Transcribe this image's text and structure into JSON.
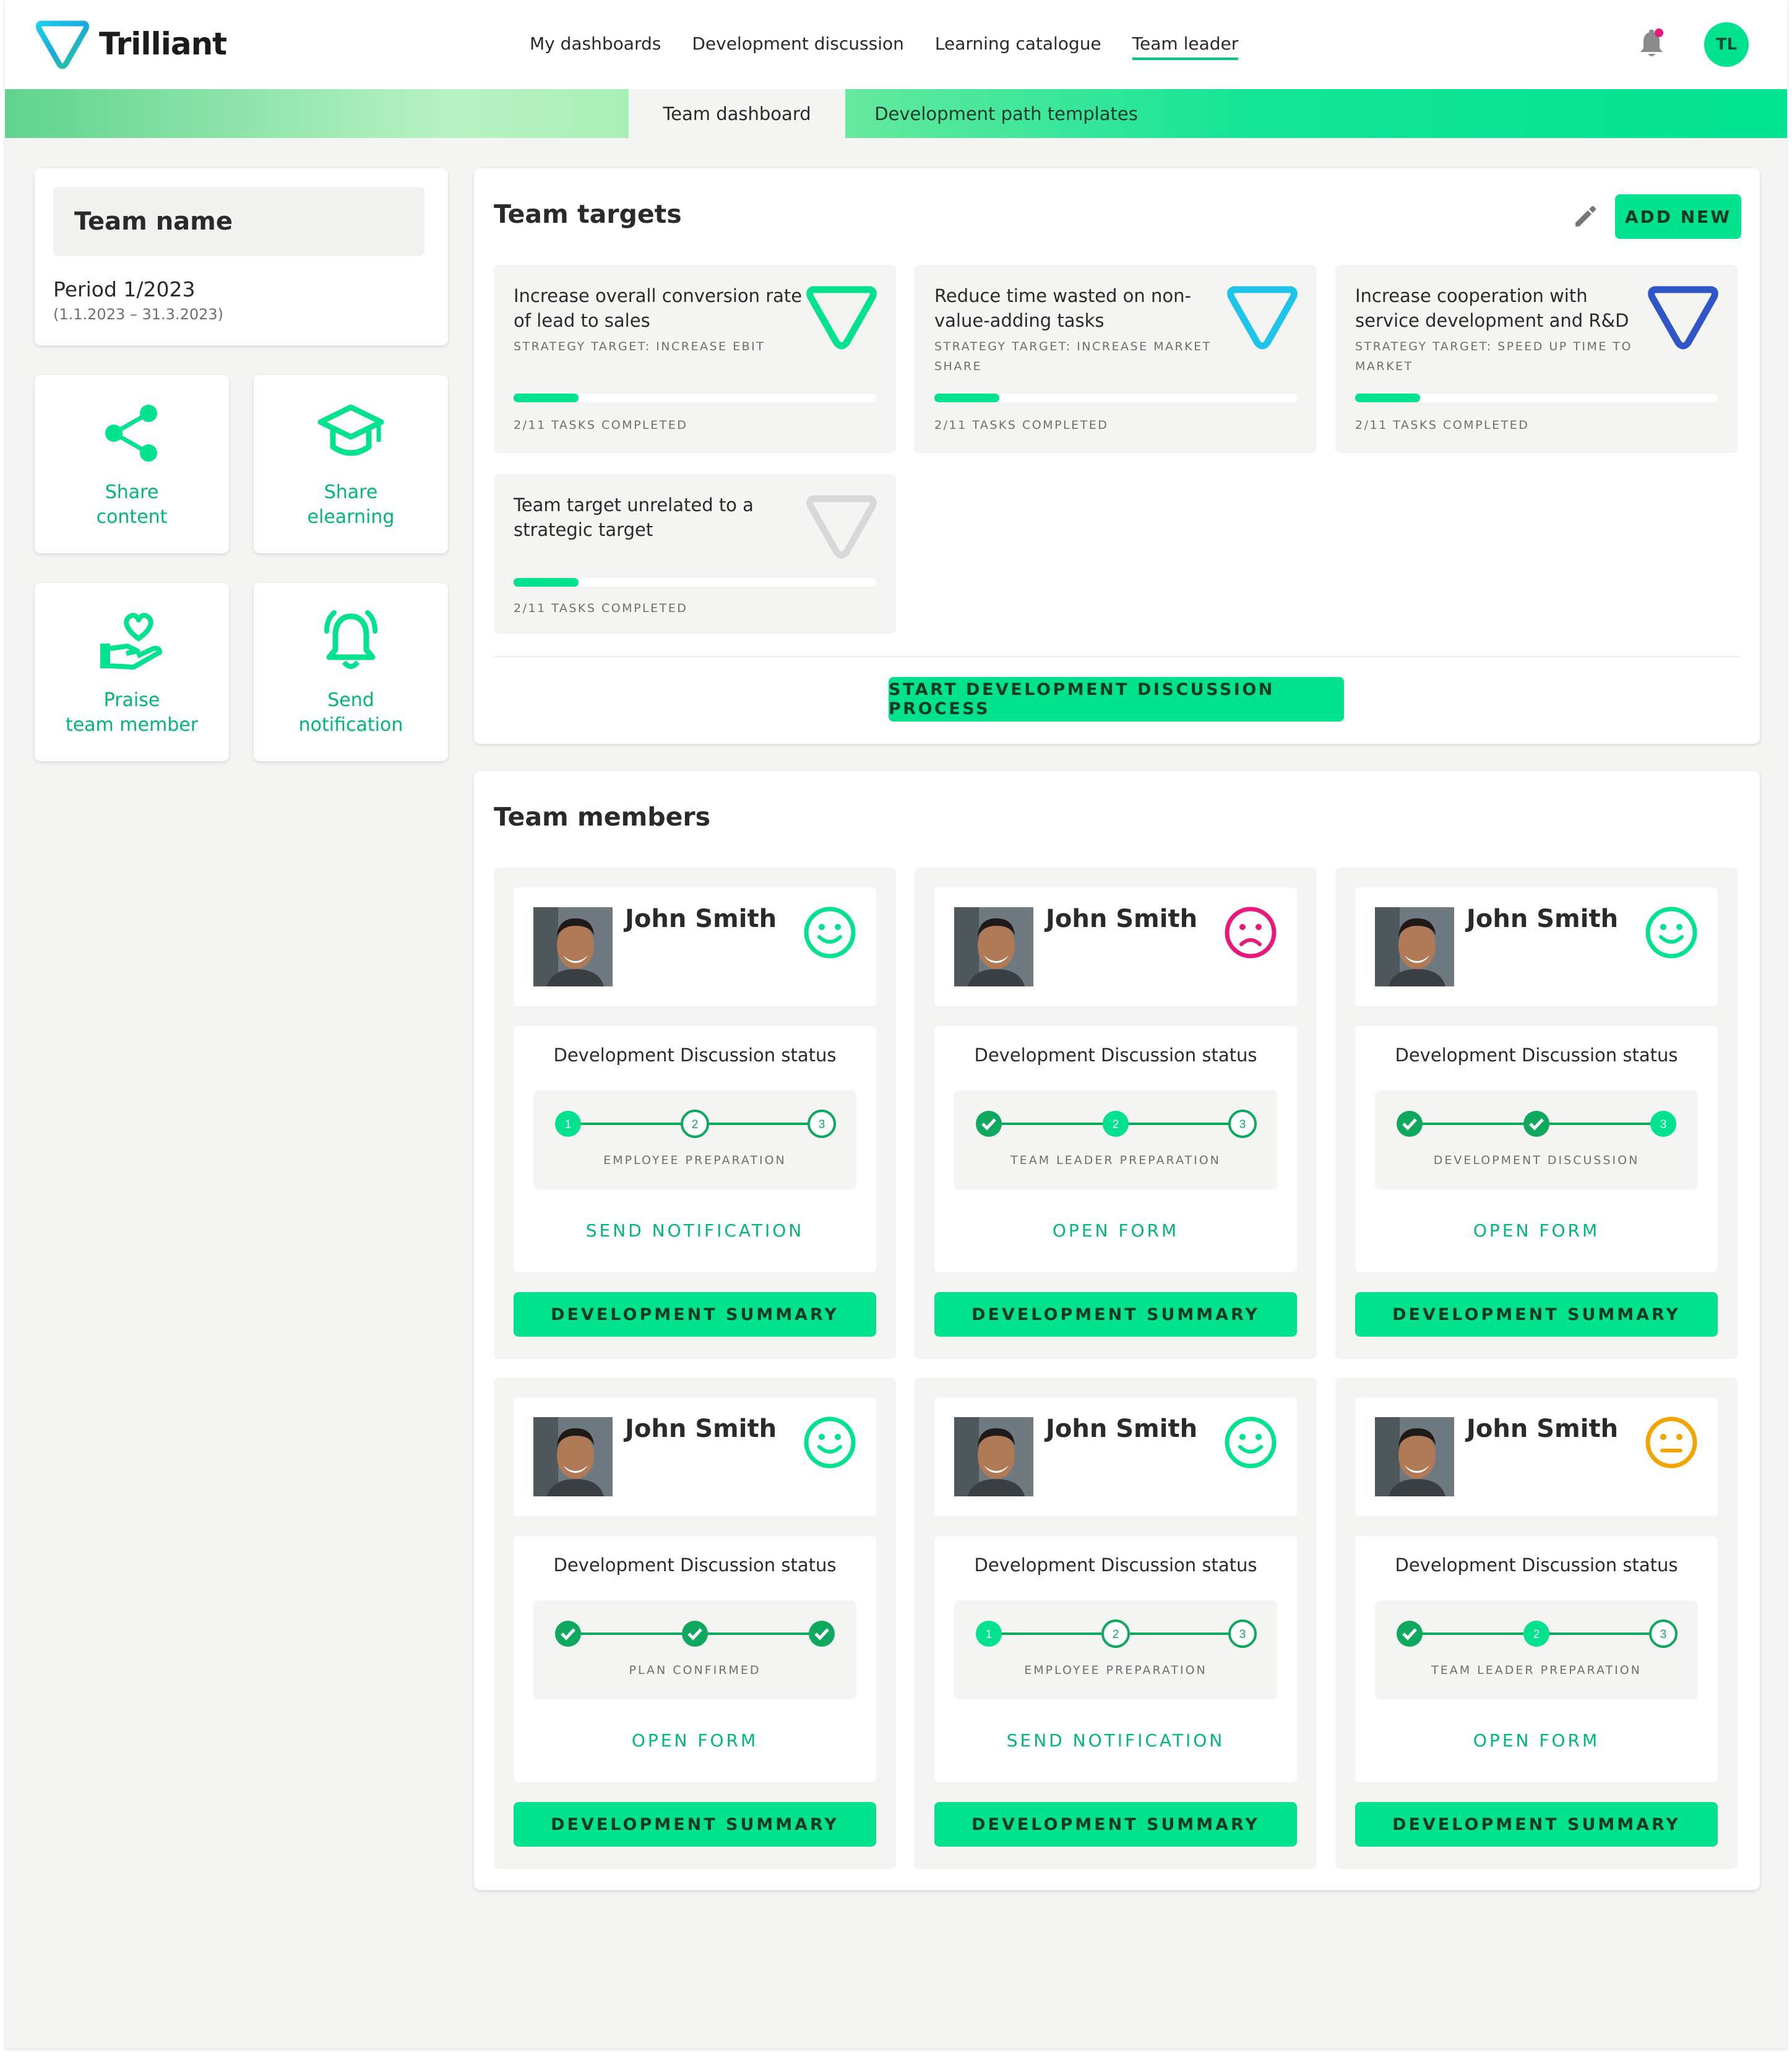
{
  "app": {
    "name": "Trilliant",
    "user_initials": "TL"
  },
  "nav": [
    "My dashboards",
    "Development discussion",
    "Learning catalogue",
    "Team leader"
  ],
  "nav_active": "Team leader",
  "subnav": {
    "active": "Team dashboard",
    "other": "Development path templates"
  },
  "team": {
    "name": "Team name",
    "period": "Period 1/2023",
    "period_range": "(1.1.2023 – 31.3.2023)"
  },
  "actions": [
    {
      "label_1": "Share",
      "label_2": "content",
      "icon": "share-icon"
    },
    {
      "label_1": "Share",
      "label_2": "elearning",
      "icon": "graduation-cap-icon"
    },
    {
      "label_1": "Praise",
      "label_2": "team member",
      "icon": "heart-hand-icon"
    },
    {
      "label_1": "Send",
      "label_2": "notification",
      "icon": "bell-ringing-icon"
    }
  ],
  "targets": {
    "title": "Team targets",
    "add_new": "ADD NEW",
    "start_button": "START DEVELOPMENT DISCUSSION PROCESS",
    "items": [
      {
        "title": "Increase overall conversion rate of lead to sales",
        "strategy": "STRATEGY TARGET: INCREASE EBIT",
        "progress_text": "2/11 TASKS COMPLETED",
        "progress": 0.18,
        "color": "#00e28e"
      },
      {
        "title": "Reduce time wasted on non-value-adding tasks",
        "strategy": "STRATEGY TARGET: INCREASE MARKET SHARE",
        "progress_text": "2/11 TASKS COMPLETED",
        "progress": 0.18,
        "color": "#1fc4ea"
      },
      {
        "title": "Increase cooperation with service development and R&D",
        "strategy": "STRATEGY TARGET: SPEED UP TIME TO MARKET",
        "progress_text": "2/11 TASKS COMPLETED",
        "progress": 0.18,
        "color": "#2f55c9"
      },
      {
        "title": "Team target unrelated to a strategic target",
        "strategy": "",
        "progress_text": "2/11 TASKS COMPLETED",
        "progress": 0.18,
        "color": "#d8d8d8"
      }
    ]
  },
  "members": {
    "title": "Team members",
    "status_title": "Development Discussion status",
    "summary_label": "DEVELOPMENT SUMMARY",
    "items": [
      {
        "name": "John Smith",
        "mood": "happy",
        "mood_color": "#00e28e",
        "steps": [
          "current",
          "todo",
          "todo"
        ],
        "step_label": "EMPLOYEE PREPARATION",
        "action": "SEND NOTIFICATION"
      },
      {
        "name": "John Smith",
        "mood": "sad",
        "mood_color": "#e8197a",
        "steps": [
          "done",
          "current",
          "todo"
        ],
        "step_label": "TEAM LEADER PREPARATION",
        "action": "OPEN FORM"
      },
      {
        "name": "John Smith",
        "mood": "happy",
        "mood_color": "#00e28e",
        "steps": [
          "done",
          "done",
          "current"
        ],
        "step_label": "DEVELOPMENT DISCUSSION",
        "action": "OPEN FORM"
      },
      {
        "name": "John Smith",
        "mood": "happy",
        "mood_color": "#00e28e",
        "steps": [
          "done",
          "done",
          "done"
        ],
        "step_label": "PLAN CONFIRMED",
        "action": "OPEN FORM"
      },
      {
        "name": "John Smith",
        "mood": "happy",
        "mood_color": "#00e28e",
        "steps": [
          "current",
          "todo",
          "todo"
        ],
        "step_label": "EMPLOYEE PREPARATION",
        "action": "SEND NOTIFICATION"
      },
      {
        "name": "John Smith",
        "mood": "neutral",
        "mood_color": "#f5a300",
        "steps": [
          "done",
          "current",
          "todo"
        ],
        "step_label": "TEAM LEADER PREPARATION",
        "action": "OPEN FORM"
      }
    ]
  },
  "colors": {
    "accent": "#00e28e",
    "accent_text": "#00b873",
    "done_step": "#0fa85f"
  }
}
